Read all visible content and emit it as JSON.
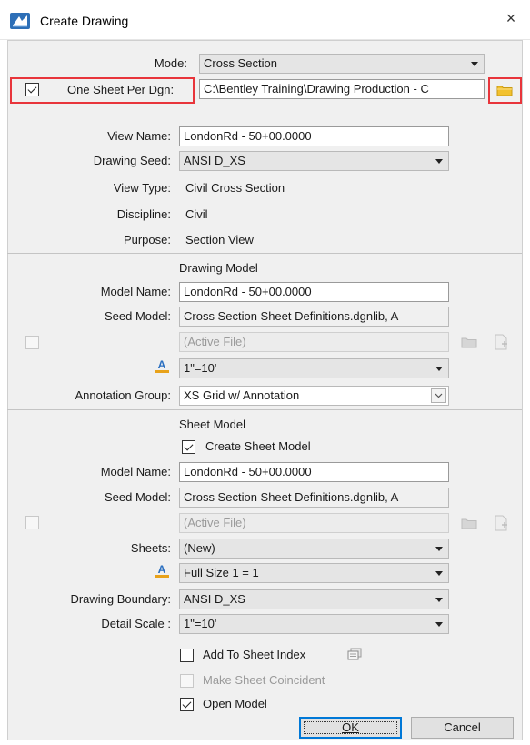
{
  "window": {
    "title": "Create Drawing",
    "close_glyph": "×"
  },
  "mode": {
    "label": "Mode:",
    "value": "Cross Section"
  },
  "one_sheet": {
    "label": "One Sheet Per Dgn:",
    "checked": true,
    "path": "C:\\Bentley Training\\Drawing Production - C"
  },
  "view": {
    "view_name_label": "View Name:",
    "view_name_value": "LondonRd - 50+00.0000",
    "drawing_seed_label": "Drawing Seed:",
    "drawing_seed_value": "ANSI D_XS",
    "view_type_label": "View Type:",
    "view_type_value": "Civil Cross Section",
    "discipline_label": "Discipline:",
    "discipline_value": "Civil",
    "purpose_label": "Purpose:",
    "purpose_value": "Section View"
  },
  "drawing_model": {
    "section_title": "Drawing Model",
    "model_name_label": "Model Name:",
    "model_name_value": "LondonRd - 50+00.0000",
    "seed_model_label": "Seed Model:",
    "seed_model_value": "Cross Section Sheet Definitions.dgnlib, A",
    "active_file": "(Active File)",
    "annotation_scale_value": "1\"=10'",
    "annotation_group_label": "Annotation Group:",
    "annotation_group_value": "XS Grid w/ Annotation"
  },
  "sheet_model": {
    "section_title": "Sheet Model",
    "create_sheet_model_label": "Create Sheet Model",
    "create_sheet_model_checked": true,
    "model_name_label": "Model Name:",
    "model_name_value": "LondonRd - 50+00.0000",
    "seed_model_label": "Seed Model:",
    "seed_model_value": "Cross Section Sheet Definitions.dgnlib, A",
    "active_file": "(Active File)",
    "sheets_label": "Sheets:",
    "sheets_value": "(New)",
    "annotation_scale_value": "Full Size 1 = 1",
    "drawing_boundary_label": "Drawing Boundary:",
    "drawing_boundary_value": "ANSI D_XS",
    "detail_scale_label": "Detail Scale :",
    "detail_scale_value": "1\"=10'"
  },
  "options": {
    "add_to_sheet_index_label": "Add To Sheet Index",
    "add_to_sheet_index_checked": false,
    "make_sheet_coincident_label": "Make Sheet Coincident",
    "make_sheet_coincident_checked": false,
    "open_model_label": "Open Model",
    "open_model_checked": true
  },
  "buttons": {
    "ok_label": "OK",
    "cancel_label": "Cancel"
  },
  "colors": {
    "highlight_red": "#e8353b",
    "accent_blue": "#0078d7",
    "folder_yellow": "#f2c12e"
  }
}
